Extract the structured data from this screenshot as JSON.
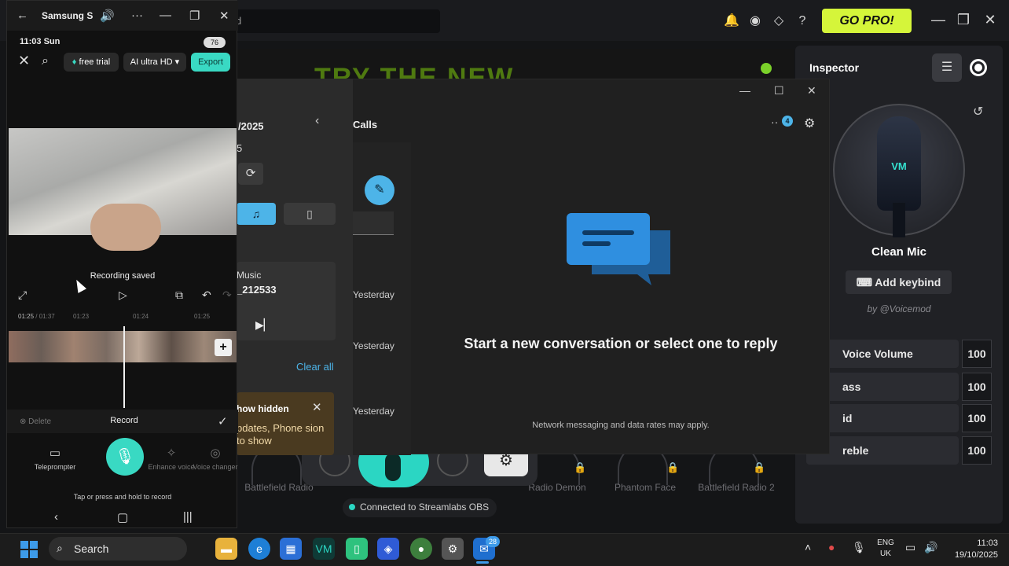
{
  "voicemod": {
    "search_text": "d",
    "go_pro": "GO PRO!",
    "banner_text": "TRY THE NEW",
    "voices": [
      "Battlefield Radio",
      "Radio Demon",
      "Phantom Face",
      "Battlefield Radio 2"
    ],
    "status": "Connected to Streamlabs OBS",
    "accent": "#2bd6c3",
    "inspector": {
      "title": "Inspector",
      "mic_name": "Clean Mic",
      "add_keybind": "Add keybind",
      "author": "by @Voicemod",
      "sliders": [
        {
          "label": "Voice Volume",
          "value": "100"
        },
        {
          "label": "ass",
          "value": "100"
        },
        {
          "label": "id",
          "value": "100"
        },
        {
          "label": "reble",
          "value": "100"
        }
      ]
    }
  },
  "phone_link": {
    "date_partial": "/2025",
    "date_partial2": "5",
    "calls": "Calls",
    "music_label": "Music",
    "music_file": "_212533",
    "clear_all": "Clear all",
    "notif_title": "how hidden",
    "notif_body": "pdates, Phone sion to show",
    "yesterday": [
      "Yesterday",
      "Yesterday",
      "Yesterday"
    ],
    "badge": "4",
    "empty_title": "Start a new conversation or select one to reply",
    "note": "Network messaging and data rates may apply.",
    "accent": "#4db4e8"
  },
  "phone": {
    "window_title": "Samsung S",
    "status_time": "11:03 Sun",
    "battery": "76",
    "free_trial": "free trial",
    "ai_quality": "AI ultra HD",
    "export": "Export",
    "recording_saved": "Recording saved",
    "time_current": "01:25",
    "time_total": "/ 01:37",
    "ticks": [
      "01:23",
      "01:24",
      "01:25"
    ],
    "delete": "Delete",
    "record": "Record",
    "tools": [
      "Teleprompter",
      "Enhance voice",
      "Voice changer"
    ],
    "hint": "Tap or press and hold to record"
  },
  "taskbar": {
    "search": "Search",
    "badge": "28",
    "lang_line1": "ENG",
    "lang_line2": "UK",
    "time": "11:03",
    "date": "19/10/2025"
  }
}
